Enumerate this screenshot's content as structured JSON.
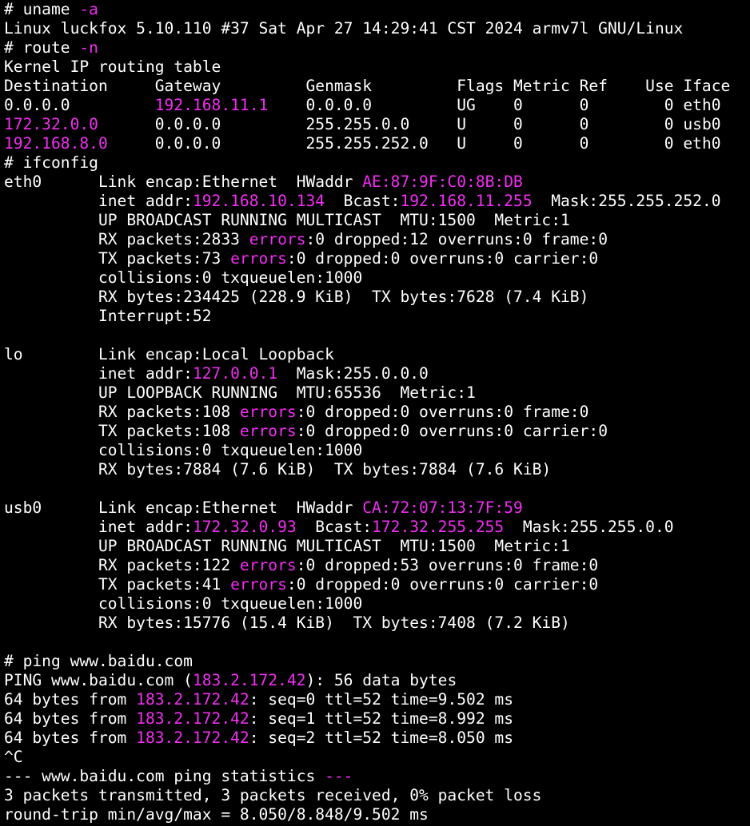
{
  "colors": {
    "background": "#000000",
    "text": "#ffffff",
    "highlight": "#f32df3"
  },
  "terminal": {
    "lines": [
      {
        "segs": [
          {
            "t": "# uname "
          },
          {
            "t": "-a",
            "h": true
          }
        ]
      },
      {
        "segs": [
          {
            "t": "Linux luckfox 5.10.110 #37 Sat Apr 27 14:29:41 CST 2024 armv7l GNU/Linux"
          }
        ]
      },
      {
        "segs": [
          {
            "t": "# route "
          },
          {
            "t": "-n",
            "h": true
          }
        ]
      },
      {
        "segs": [
          {
            "t": "Kernel IP routing table"
          }
        ]
      },
      {
        "segs": [
          {
            "t": "Destination     Gateway         Genmask         Flags Metric Ref    Use Iface"
          }
        ]
      },
      {
        "segs": [
          {
            "t": "0.0.0.0         "
          },
          {
            "t": "192.168.11.1",
            "h": true
          },
          {
            "t": "    0.0.0.0         UG    0      0        0 eth0"
          }
        ]
      },
      {
        "segs": [
          {
            "t": "172.32.0.0",
            "h": true
          },
          {
            "t": "      0.0.0.0         255.255.0.0     U     0      0        0 usb0"
          }
        ]
      },
      {
        "segs": [
          {
            "t": "192.168.8.0",
            "h": true
          },
          {
            "t": "     0.0.0.0         255.255.252.0   U     0      0        0 eth0"
          }
        ]
      },
      {
        "segs": [
          {
            "t": "# ifconfig"
          }
        ]
      },
      {
        "segs": [
          {
            "t": "eth0      Link encap:Ethernet  HWaddr "
          },
          {
            "t": "AE:87:9F:C0:8B:DB",
            "h": true
          }
        ]
      },
      {
        "segs": [
          {
            "t": "          inet addr:"
          },
          {
            "t": "192.168.10.134",
            "h": true
          },
          {
            "t": "  Bcast:"
          },
          {
            "t": "192.168.11.255",
            "h": true
          },
          {
            "t": "  Mask:255.255.252.0"
          }
        ]
      },
      {
        "segs": [
          {
            "t": "          UP BROADCAST RUNNING MULTICAST  MTU:1500  Metric:1"
          }
        ]
      },
      {
        "segs": [
          {
            "t": "          RX packets:2833 "
          },
          {
            "t": "errors",
            "h": true
          },
          {
            "t": ":0 dropped:12 overruns:0 frame:0"
          }
        ]
      },
      {
        "segs": [
          {
            "t": "          TX packets:73 "
          },
          {
            "t": "errors",
            "h": true
          },
          {
            "t": ":0 dropped:0 overruns:0 carrier:0"
          }
        ]
      },
      {
        "segs": [
          {
            "t": "          collisions:0 txqueuelen:1000"
          }
        ]
      },
      {
        "segs": [
          {
            "t": "          RX bytes:234425 (228.9 KiB)  TX bytes:7628 (7.4 KiB)"
          }
        ]
      },
      {
        "segs": [
          {
            "t": "          Interrupt:52"
          }
        ]
      },
      {
        "segs": [
          {
            "t": ""
          }
        ]
      },
      {
        "segs": [
          {
            "t": "lo        Link encap:Local Loopback"
          }
        ]
      },
      {
        "segs": [
          {
            "t": "          inet addr:"
          },
          {
            "t": "127.0.0.1",
            "h": true
          },
          {
            "t": "  Mask:255.0.0.0"
          }
        ]
      },
      {
        "segs": [
          {
            "t": "          UP LOOPBACK RUNNING  MTU:65536  Metric:1"
          }
        ]
      },
      {
        "segs": [
          {
            "t": "          RX packets:108 "
          },
          {
            "t": "errors",
            "h": true
          },
          {
            "t": ":0 dropped:0 overruns:0 frame:0"
          }
        ]
      },
      {
        "segs": [
          {
            "t": "          TX packets:108 "
          },
          {
            "t": "errors",
            "h": true
          },
          {
            "t": ":0 dropped:0 overruns:0 carrier:0"
          }
        ]
      },
      {
        "segs": [
          {
            "t": "          collisions:0 txqueuelen:1000"
          }
        ]
      },
      {
        "segs": [
          {
            "t": "          RX bytes:7884 (7.6 KiB)  TX bytes:7884 (7.6 KiB)"
          }
        ]
      },
      {
        "segs": [
          {
            "t": ""
          }
        ]
      },
      {
        "segs": [
          {
            "t": "usb0      Link encap:Ethernet  HWaddr "
          },
          {
            "t": "CA:72:07:13:7F:59",
            "h": true
          }
        ]
      },
      {
        "segs": [
          {
            "t": "          inet addr:"
          },
          {
            "t": "172.32.0.93",
            "h": true
          },
          {
            "t": "  Bcast:"
          },
          {
            "t": "172.32.255.255",
            "h": true
          },
          {
            "t": "  Mask:255.255.0.0"
          }
        ]
      },
      {
        "segs": [
          {
            "t": "          UP BROADCAST RUNNING MULTICAST  MTU:1500  Metric:1"
          }
        ]
      },
      {
        "segs": [
          {
            "t": "          RX packets:122 "
          },
          {
            "t": "errors",
            "h": true
          },
          {
            "t": ":0 dropped:53 overruns:0 frame:0"
          }
        ]
      },
      {
        "segs": [
          {
            "t": "          TX packets:41 "
          },
          {
            "t": "errors",
            "h": true
          },
          {
            "t": ":0 dropped:0 overruns:0 carrier:0"
          }
        ]
      },
      {
        "segs": [
          {
            "t": "          collisions:0 txqueuelen:1000"
          }
        ]
      },
      {
        "segs": [
          {
            "t": "          RX bytes:15776 (15.4 KiB)  TX bytes:7408 (7.2 KiB)"
          }
        ]
      },
      {
        "segs": [
          {
            "t": ""
          }
        ]
      },
      {
        "segs": [
          {
            "t": "# ping www.baidu.com"
          }
        ]
      },
      {
        "segs": [
          {
            "t": "PING www.baidu.com ("
          },
          {
            "t": "183.2.172.42",
            "h": true
          },
          {
            "t": "): 56 data bytes"
          }
        ]
      },
      {
        "segs": [
          {
            "t": "64 bytes from "
          },
          {
            "t": "183.2.172.42",
            "h": true
          },
          {
            "t": ": seq=0 ttl=52 time=9.502 ms"
          }
        ]
      },
      {
        "segs": [
          {
            "t": "64 bytes from "
          },
          {
            "t": "183.2.172.42",
            "h": true
          },
          {
            "t": ": seq=1 ttl=52 time=8.992 ms"
          }
        ]
      },
      {
        "segs": [
          {
            "t": "64 bytes from "
          },
          {
            "t": "183.2.172.42",
            "h": true
          },
          {
            "t": ": seq=2 ttl=52 time=8.050 ms"
          }
        ]
      },
      {
        "segs": [
          {
            "t": "^C"
          }
        ]
      },
      {
        "segs": [
          {
            "t": "--- www.baidu.com ping statistics "
          },
          {
            "t": "---",
            "h": true
          }
        ]
      },
      {
        "segs": [
          {
            "t": "3 packets transmitted, 3 packets received, 0% packet loss"
          }
        ]
      },
      {
        "segs": [
          {
            "t": "round-trip min/avg/max = 8.050/8.848/9.502 ms"
          }
        ]
      }
    ]
  }
}
